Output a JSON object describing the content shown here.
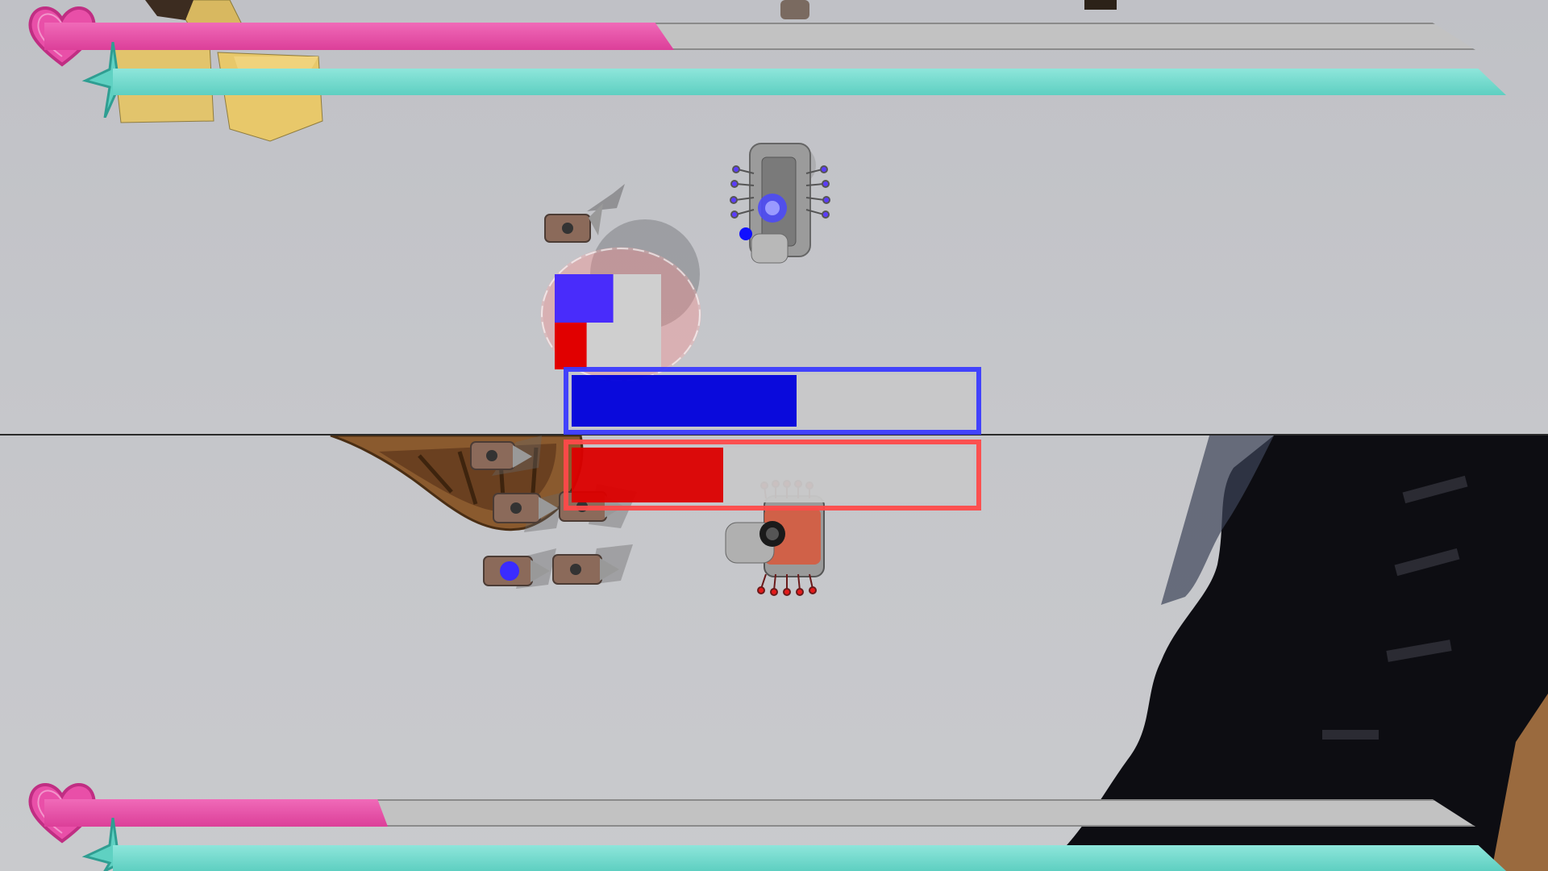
{
  "game": {
    "mode": "split-screen",
    "players": [
      {
        "id": "player-1",
        "viewport": "top",
        "health_fraction": 0.44,
        "energy_fraction": 1.0,
        "health_color": "#e0489f",
        "energy_color": "#6fd6c8",
        "unit_color": "#3a2cff",
        "icons": {
          "health": "heart-icon",
          "energy": "star-burst-icon"
        }
      },
      {
        "id": "player-2",
        "viewport": "bottom",
        "health_fraction": 0.24,
        "energy_fraction": 1.0,
        "health_color": "#e0489f",
        "energy_color": "#6fd6c8",
        "unit_color": "#e02020",
        "icons": {
          "health": "heart-icon",
          "energy": "star-burst-icon"
        }
      }
    ],
    "center_meters": [
      {
        "team": "blue",
        "fraction": 0.56,
        "color": "#0000dd",
        "frame_color": "#3b3bff"
      },
      {
        "team": "red",
        "fraction": 0.38,
        "color": "#dd0000",
        "frame_color": "#ff4a4a"
      }
    ],
    "capture_flag": {
      "blue_fraction": 0.55,
      "red_fraction": 0.3
    },
    "colors": {
      "floor": "#c4c5c9",
      "wall_dark": "#0c0c10",
      "crate": "#e0c070",
      "drone": "#8a6a5a",
      "shield": "#ff7a7a"
    }
  }
}
